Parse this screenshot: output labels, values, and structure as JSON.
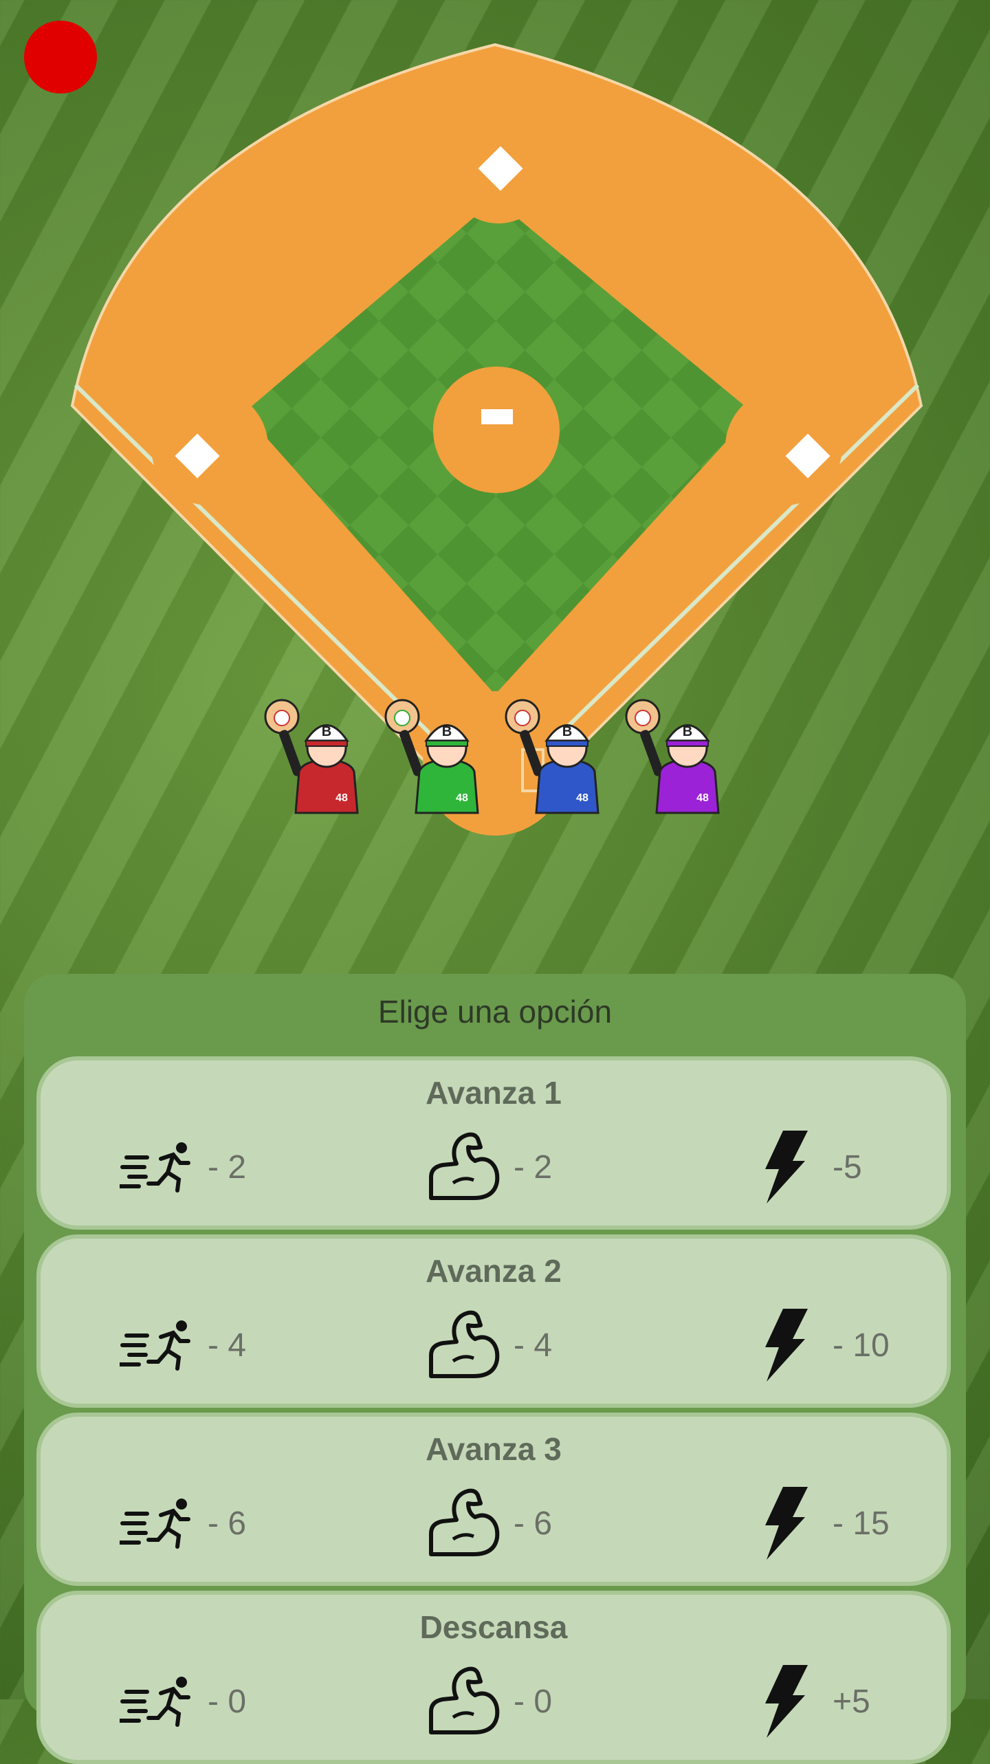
{
  "panel": {
    "title": "Elige una opción"
  },
  "options": [
    {
      "title": "Avanza 1",
      "speed": "- 2",
      "strength": "- 2",
      "energy": "-5"
    },
    {
      "title": "Avanza 2",
      "speed": "- 4",
      "strength": "- 4",
      "energy": "- 10"
    },
    {
      "title": "Avanza 3",
      "speed": "- 6",
      "strength": "- 6",
      "energy": "- 15"
    },
    {
      "title": "Descansa",
      "speed": "- 0",
      "strength": "- 0",
      "energy": "+5"
    }
  ],
  "players": [
    {
      "cap_letter": "B",
      "number": "48",
      "color": "#c7282d"
    },
    {
      "cap_letter": "B",
      "number": "48",
      "color": "#2fb53a"
    },
    {
      "cap_letter": "B",
      "number": "48",
      "color": "#2f57c9"
    },
    {
      "cap_letter": "B",
      "number": "48",
      "color": "#9b22d6"
    }
  ],
  "colors": {
    "dirt": "#f2a03d",
    "infield_grass": "#5aa03a",
    "record": "#e00000",
    "panel": "#6a9a4c",
    "card": "#c5d9b8"
  },
  "icons": {
    "speed": "running-person-icon",
    "strength": "flexed-bicep-icon",
    "energy": "lightning-bolt-icon"
  }
}
